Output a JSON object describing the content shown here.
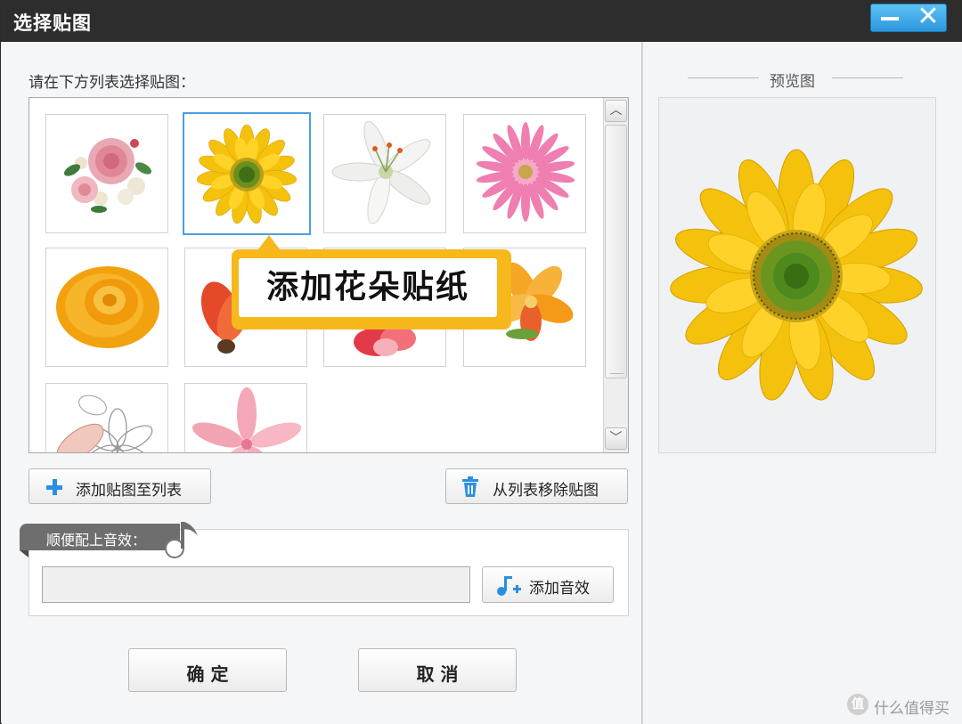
{
  "window": {
    "title": "选择贴图",
    "minimize_icon": "minimize-icon",
    "close_icon": "close-icon"
  },
  "sticker_panel": {
    "instruction": "请在下方列表选择贴图：",
    "items": [
      {
        "icon": "peony-rose-bouquet-image",
        "selected": false
      },
      {
        "icon": "sunflower-image",
        "selected": true
      },
      {
        "icon": "white-lily-image",
        "selected": false
      },
      {
        "icon": "pink-gerbera-image",
        "selected": false
      },
      {
        "icon": "orange-rose-image",
        "selected": false
      },
      {
        "icon": "red-tulip-image",
        "selected": false
      },
      {
        "icon": "red-carnation-image",
        "selected": false
      },
      {
        "icon": "orange-lily-image",
        "selected": false
      },
      {
        "icon": "line-art-flowers-image",
        "selected": false
      },
      {
        "icon": "pink-petals-image",
        "selected": false
      }
    ],
    "callout_text": "添加花朵贴纸",
    "add_button": "添加贴图至列表",
    "remove_button": "从列表移除贴图"
  },
  "sound": {
    "tag_label": "顺便配上音效：",
    "field_value": "",
    "add_sound_button": "添加音效"
  },
  "footer": {
    "ok_button": "确 定",
    "cancel_button": "取 消"
  },
  "preview": {
    "title": "预览图"
  },
  "watermark": {
    "logo_char": "值",
    "text": "什么值得买"
  },
  "colors": {
    "titlebar": "#2d2d2d",
    "accent_blue": "#2e98dc",
    "callout": "#f6b81a",
    "sunflower_petal": "#f4c20d",
    "sunflower_center": "#4e8a1c"
  }
}
